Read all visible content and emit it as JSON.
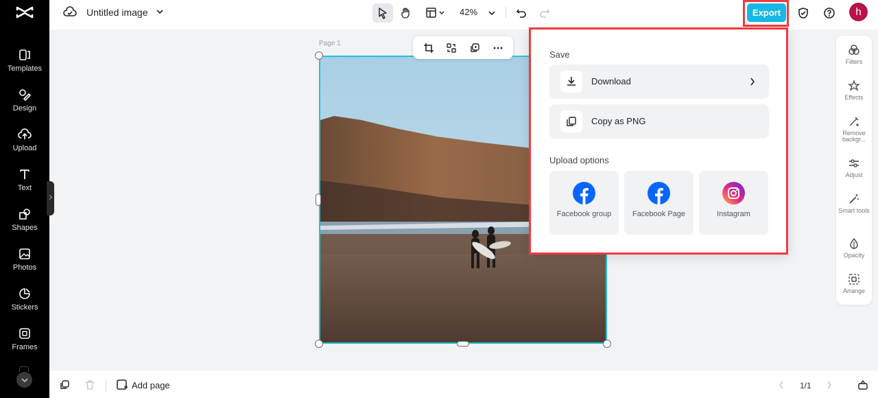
{
  "app": {
    "name": "CapCut"
  },
  "header": {
    "doc_title": "Untitled image",
    "zoom": "42%",
    "export_label": "Export",
    "user_initial": "h"
  },
  "sidebar": {
    "items": [
      {
        "id": "templates",
        "label": "Templates",
        "icon": "templates-icon"
      },
      {
        "id": "design",
        "label": "Design",
        "icon": "design-icon"
      },
      {
        "id": "upload",
        "label": "Upload",
        "icon": "upload-icon"
      },
      {
        "id": "text",
        "label": "Text",
        "icon": "text-icon"
      },
      {
        "id": "shapes",
        "label": "Shapes",
        "icon": "shapes-icon"
      },
      {
        "id": "photos",
        "label": "Photos",
        "icon": "photos-icon"
      },
      {
        "id": "stickers",
        "label": "Stickers",
        "icon": "stickers-icon"
      },
      {
        "id": "frames",
        "label": "Frames",
        "icon": "frames-icon"
      }
    ]
  },
  "canvas": {
    "page_label": "Page 1"
  },
  "right_toolbar": {
    "items": [
      {
        "label": "Filters"
      },
      {
        "label": "Effects"
      },
      {
        "label": "Remove backgr..."
      },
      {
        "label": "Adjust"
      },
      {
        "label": "Smart tools"
      },
      {
        "label": "Opacity"
      },
      {
        "label": "Arrange"
      }
    ]
  },
  "export_panel": {
    "save_title": "Save",
    "download_label": "Download",
    "copy_label": "Copy as PNG",
    "upload_title": "Upload options",
    "share": [
      {
        "label": "Facebook group",
        "icon": "facebook-icon"
      },
      {
        "label": "Facebook Page",
        "icon": "facebook-icon"
      },
      {
        "label": "Instagram",
        "icon": "instagram-icon"
      }
    ]
  },
  "footer": {
    "add_page_label": "Add page",
    "page_count": "1/1"
  },
  "colors": {
    "accent": "#17b7e6",
    "highlight": "#f03a3f",
    "selection": "#22c3d6",
    "avatar": "#b8124a"
  }
}
